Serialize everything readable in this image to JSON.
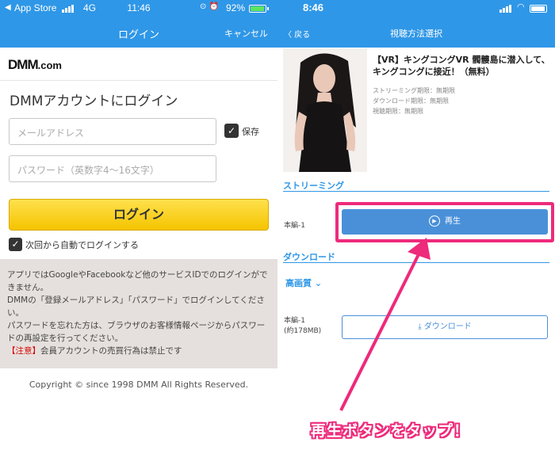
{
  "left": {
    "status_bar": {
      "back_glyph": "◀",
      "carrier": "App Store",
      "network": "4G",
      "time": "11:46",
      "battery_pct": "92%",
      "battery_level": 0.92
    },
    "nav": {
      "title": "ログイン",
      "cancel": "キャンセル"
    },
    "logo": {
      "brand": "DMM",
      "suffix": ".com"
    },
    "heading": "DMMアカウントにログイン",
    "email": {
      "placeholder": "メールアドレス",
      "value": ""
    },
    "password": {
      "placeholder": "パスワード（英数字4〜16文字）",
      "value": ""
    },
    "save": {
      "checked": true,
      "label": "保存"
    },
    "login_button": "ログイン",
    "auto_login": {
      "checked": true,
      "label": "次回から自動でログインする"
    },
    "info": {
      "line1": "アプリではGoogleやFacebookなど他のサービスIDでのログインができません。",
      "line2": "DMMの「登録メールアドレス」「パスワード」でログインしてください。",
      "line3": "パスワードを忘れた方は、ブラウザのお客様情報ページからパスワードの再設定を行ってください。",
      "warn_tag": "【注意】",
      "warn_text": "会員アカウントの売買行為は禁止です"
    },
    "copyright": "Copyright © since 1998 DMM All Rights Reserved."
  },
  "right": {
    "status_bar": {
      "time": "8:46",
      "battery_level": 0.95
    },
    "nav": {
      "back": "〈 戻る",
      "title": "視聴方法選択"
    },
    "video": {
      "title": "【VR】キングコングVR 髑髏島に潜入して、キングコングに接近！（無料）",
      "streaming_period": "ストリーミング期限：無期限",
      "download_period": "ダウンロード期限：無期限",
      "view_period": "視聴期限：無期限"
    },
    "streaming_section": "ストリーミング",
    "episode1": "本編-1",
    "play_button": "再生",
    "download_section": "ダウンロード",
    "quality": "高画質",
    "episode2": "本編-1",
    "episode2_size": "(約178MB)",
    "download_button": "ダウンロード"
  },
  "annotation": {
    "callout": "再生ボタンをタップ！",
    "accent_color": "#ee2a7b"
  },
  "colors": {
    "nav_blue": "#2f97e7",
    "button_blue": "#4a90d9",
    "login_yellow": "#f5c400",
    "info_bg": "#e5e0dd",
    "warning_red": "#d60000"
  }
}
